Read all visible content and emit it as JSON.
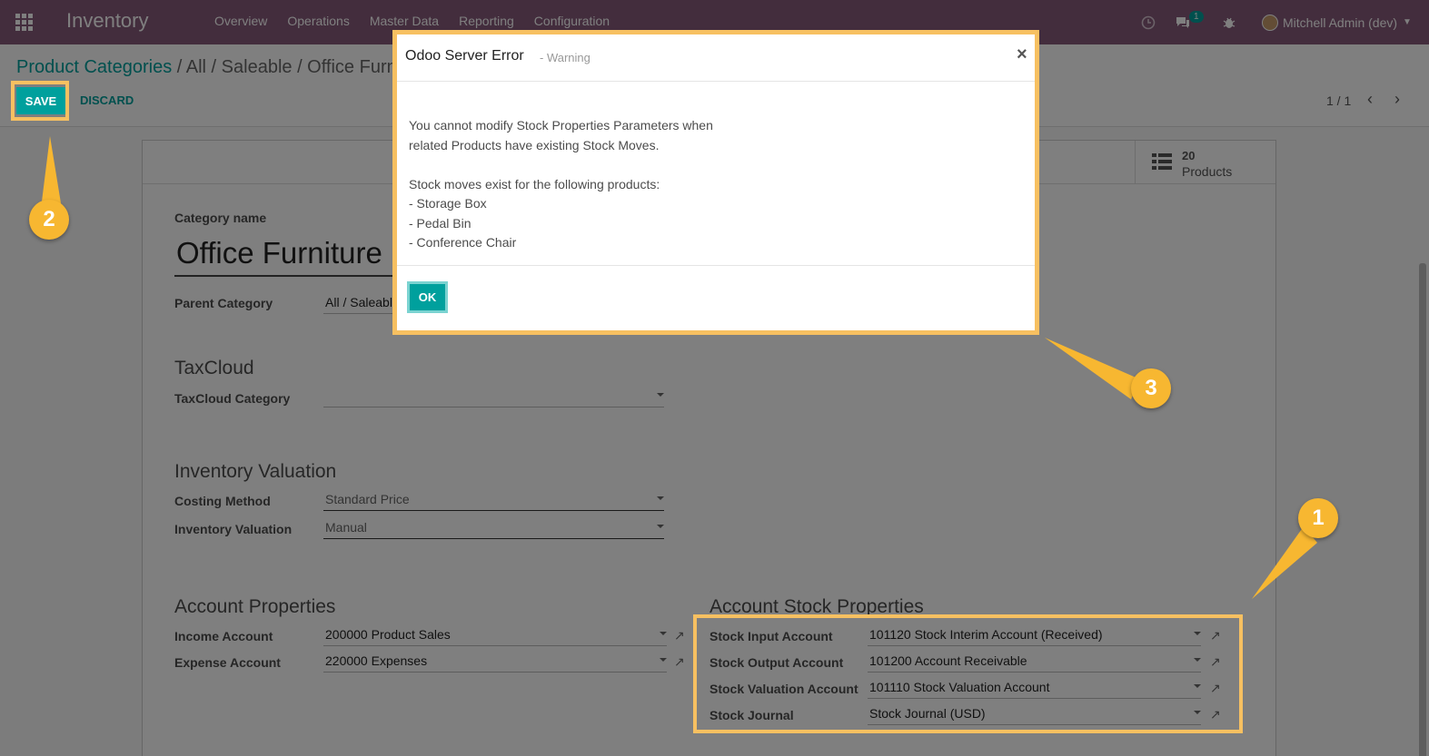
{
  "navbar": {
    "app_title": "Inventory",
    "menu": [
      "Overview",
      "Operations",
      "Master Data",
      "Reporting",
      "Configuration"
    ],
    "chat_badge": "1",
    "user": "Mitchell Admin (dev)"
  },
  "control": {
    "breadcrumb_link": "Product Categories",
    "breadcrumb_current": " / All / Saleable / Office Furniture",
    "save_label": "SAVE",
    "discard_label": "DISCARD",
    "pager": "1 / 1"
  },
  "form": {
    "smart_button": {
      "value": "20",
      "label": "Products"
    },
    "category_name_label": "Category name",
    "category_name": "Office Furniture",
    "parent_label": "Parent Category",
    "parent_value": "All / Saleable",
    "taxcloud_title": "TaxCloud",
    "taxcloud_label": "TaxCloud Category",
    "taxcloud_value": "",
    "valuation_title": "Inventory Valuation",
    "costing_label": "Costing Method",
    "costing_value": "Standard Price",
    "valuation_label": "Inventory Valuation",
    "valuation_value": "Manual",
    "account_title": "Account Properties",
    "income_label": "Income Account",
    "income_value": "200000 Product Sales",
    "expense_label": "Expense Account",
    "expense_value": "220000 Expenses",
    "stock_title": "Account Stock Properties",
    "stock_input_label": "Stock Input Account",
    "stock_input_value": "101120 Stock Interim Account (Received)",
    "stock_output_label": "Stock Output Account",
    "stock_output_value": "101200 Account Receivable",
    "stock_valuation_label": "Stock Valuation Account",
    "stock_valuation_value": "101110 Stock Valuation Account",
    "stock_journal_label": "Stock Journal",
    "stock_journal_value": "Stock Journal (USD)"
  },
  "modal": {
    "title": "Odoo Server Error",
    "subtitle": "- Warning",
    "close": "×",
    "lines": [
      "You cannot modify Stock Properties Parameters when",
      "related Products have existing Stock Moves.",
      "",
      "Stock moves exist for the following products:",
      "- Storage Box",
      "- Pedal Bin",
      "- Conference Chair"
    ],
    "ok_label": "OK"
  },
  "callouts": [
    "1",
    "2",
    "3"
  ],
  "colors": {
    "brand": "#875a7b",
    "accent": "#00a09d",
    "highlight": "#f7c061"
  }
}
